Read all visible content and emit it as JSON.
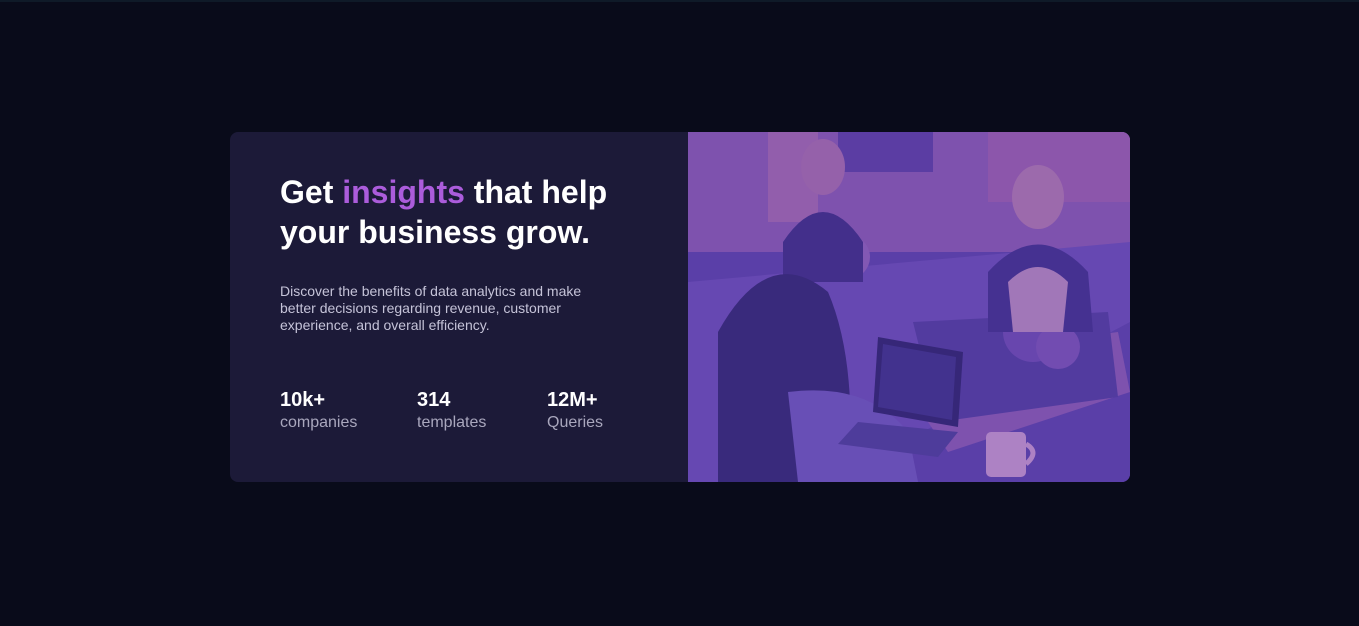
{
  "hero": {
    "headline_before": "Get ",
    "headline_accent": "insights",
    "headline_after": " that help your business grow.",
    "description": "Discover the benefits of data analytics and make better decisions regarding revenue, customer experience, and overall efficiency."
  },
  "stats": [
    {
      "value": "10k+",
      "label": "companies"
    },
    {
      "value": "314",
      "label": "templates"
    },
    {
      "value": "12M+",
      "label": "Queries"
    }
  ],
  "colors": {
    "page_background": "#090b1a",
    "card_background": "#1c1a38",
    "accent": "#ab5cdb",
    "image_tint": "#4b3b9c"
  },
  "image": {
    "subject": "people working at laptops in an office (purple tint)"
  }
}
